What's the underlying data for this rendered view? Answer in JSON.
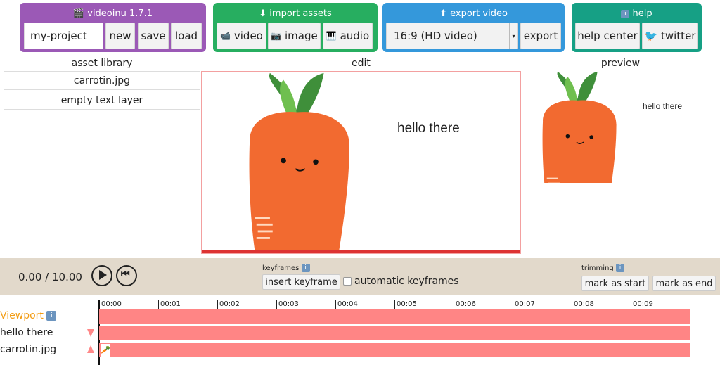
{
  "project": {
    "title": "videoinu 1.7.1",
    "name_value": "my-project",
    "new": "new",
    "save": "save",
    "load": "load",
    "color": "#9b59b6"
  },
  "import": {
    "title": "import assets",
    "video": "video",
    "image": "image",
    "audio": "audio",
    "color": "#27ae60"
  },
  "export": {
    "title": "export video",
    "format": "16:9 (HD video)",
    "export": "export",
    "color": "#3498db"
  },
  "help": {
    "title": "help",
    "help_center": "help center",
    "twitter": "twitter",
    "color": "#16a085"
  },
  "headings": {
    "assets": "asset library",
    "edit": "edit",
    "preview": "preview"
  },
  "assets": [
    "carrotin.jpg",
    "empty text layer"
  ],
  "canvas": {
    "text": "hello there"
  },
  "preview": {
    "text": "hello there"
  },
  "controls": {
    "time": "0.00 / 10.00",
    "keyframes_label": "keyframes",
    "insert_keyframe": "insert keyframe",
    "auto_keyframes": "automatic keyframes",
    "auto_keyframes_checked": false,
    "trimming_label": "trimming",
    "mark_start": "mark as start",
    "mark_end": "mark as end"
  },
  "timeline": {
    "ticks": [
      "00:00",
      "00:01",
      "00:02",
      "00:03",
      "00:04",
      "00:05",
      "00:06",
      "00:07",
      "00:08",
      "00:09"
    ],
    "tracks": [
      "Viewport",
      "hello there",
      "carrotin.jpg"
    ],
    "track_color": "#ff8585",
    "viewport_color": "#f39c12"
  }
}
